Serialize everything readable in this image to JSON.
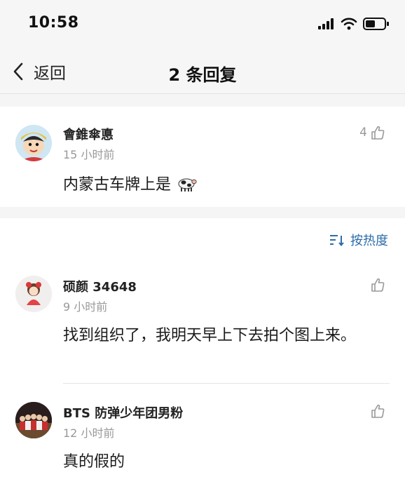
{
  "status_bar": {
    "time": "10:58"
  },
  "nav": {
    "back_label": "返回",
    "title": "2 条回复"
  },
  "original_comment": {
    "username": "會錐傘悳",
    "time": "15 小时前",
    "content": "内蒙古车牌上是",
    "content_emoji": "cow",
    "like_count": "4"
  },
  "sort": {
    "label": "按热度"
  },
  "replies": [
    {
      "username": "硕颜 34648",
      "time": "9 小时前",
      "content": "找到组织了，我明天早上下去拍个图上来。",
      "like_count": ""
    },
    {
      "username": "BTS 防弹少年团男粉",
      "time": "12 小时前",
      "content": "真的假的",
      "like_count": ""
    }
  ],
  "colors": {
    "accent": "#2d6ca8",
    "meta_text": "#999999",
    "page_bg": "#f5f5f5"
  }
}
